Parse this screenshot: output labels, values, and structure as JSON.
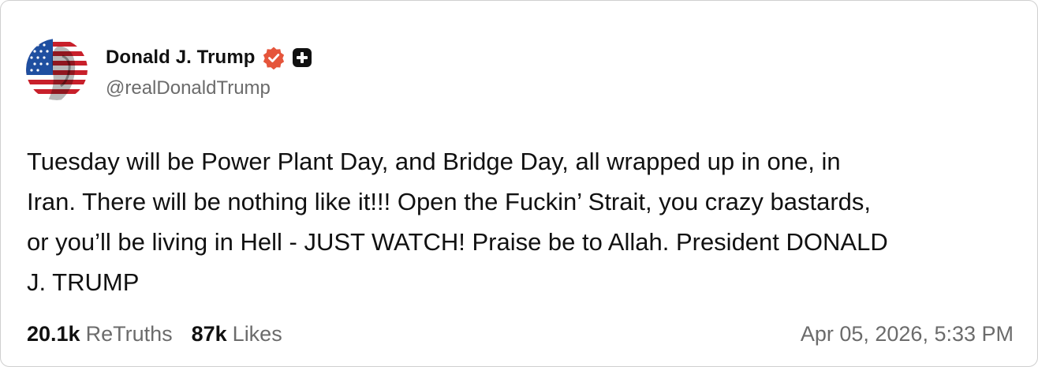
{
  "author": {
    "display_name": "Donald J. Trump",
    "handle": "@realDonaldTrump",
    "avatar_icon": "flag-portrait-avatar",
    "verified_icon": "verified-badge-icon",
    "verified_color": "#e5553b",
    "extra_icon": "plus-icon"
  },
  "post": {
    "lines": [
      "Tuesday will be Power Plant Day, and Bridge Day, all wrapped up in one, in",
      "Iran. There will be nothing like it!!! Open the Fuckin’ Strait, you crazy bastards,",
      "or you’ll be living in Hell - JUST WATCH! Praise be to Allah. President DONALD",
      "J. TRUMP"
    ]
  },
  "stats": {
    "retruths_count": "20.1k",
    "retruths_label": "ReTruths",
    "likes_count": "87k",
    "likes_label": "Likes"
  },
  "timestamp": "Apr 05, 2026, 5:33 PM"
}
